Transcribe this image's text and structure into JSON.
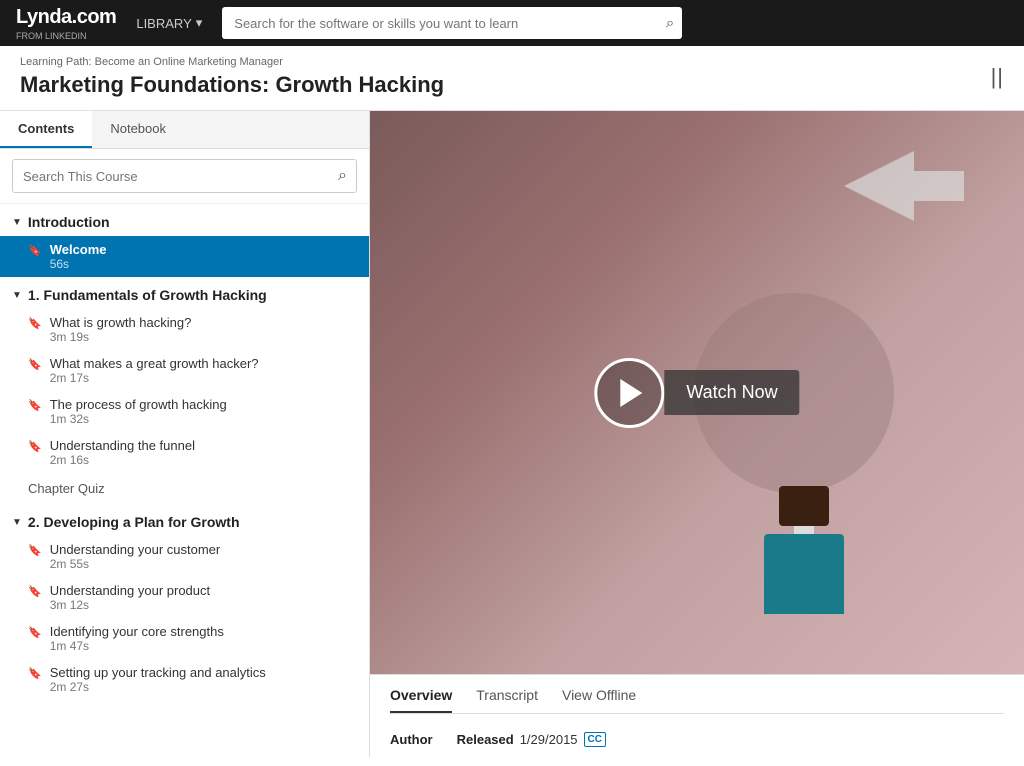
{
  "nav": {
    "logo": "Lynda.com",
    "logo_sub": "FROM LINKEDIN",
    "library_label": "LIBRARY",
    "search_placeholder": "Search for the software or skills you want to learn"
  },
  "header": {
    "breadcrumb": "Learning Path: Become an Online Marketing Manager",
    "title": "Marketing Foundations: Growth Hacking",
    "sidebar_toggle": "||"
  },
  "sidebar": {
    "tabs": [
      {
        "label": "Contents",
        "active": true
      },
      {
        "label": "Notebook",
        "active": false
      }
    ],
    "search_placeholder": "Search This Course",
    "sections": [
      {
        "title": "Introduction",
        "items": [
          {
            "title": "Welcome",
            "duration": "56s",
            "active": true
          }
        ]
      },
      {
        "title": "1. Fundamentals of Growth Hacking",
        "items": [
          {
            "title": "What is growth hacking?",
            "duration": "3m 19s"
          },
          {
            "title": "What makes a great growth hacker?",
            "duration": "2m 17s"
          },
          {
            "title": "The process of growth hacking",
            "duration": "1m 32s"
          },
          {
            "title": "Understanding the funnel",
            "duration": "2m 16s"
          }
        ],
        "quiz": "Chapter Quiz"
      },
      {
        "title": "2. Developing a Plan for Growth",
        "items": [
          {
            "title": "Understanding your customer",
            "duration": "2m 55s"
          },
          {
            "title": "Understanding your product",
            "duration": "3m 12s"
          },
          {
            "title": "Identifying your core strengths",
            "duration": "1m 47s"
          },
          {
            "title": "Setting up your tracking and analytics",
            "duration": "2m 27s"
          }
        ]
      }
    ]
  },
  "video": {
    "watch_now": "Watch Now"
  },
  "overview": {
    "tabs": [
      {
        "label": "Overview",
        "active": true
      },
      {
        "label": "Transcript",
        "active": false
      },
      {
        "label": "View Offline",
        "active": false
      }
    ],
    "author_label": "Author",
    "released_label": "Released",
    "released_date": "1/29/2015",
    "cc_label": "CC"
  }
}
